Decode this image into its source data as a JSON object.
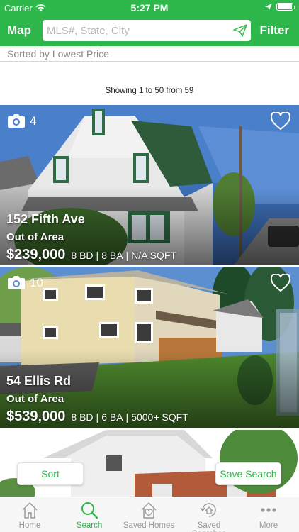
{
  "status": {
    "carrier": "Carrier",
    "time": "5:27 PM"
  },
  "nav": {
    "map_label": "Map",
    "search_placeholder": "MLS#, State, City",
    "filter_label": "Filter"
  },
  "sort_text": "Sorted by Lowest Price",
  "showing_text": "Showing 1 to 50 from 59",
  "listings": [
    {
      "photo_count": "4",
      "address": "152 Fifth Ave",
      "area": "Out of Area",
      "price": "$239,000",
      "beds": "8 BD",
      "baths": "8 BA",
      "sqft": "N/A SQFT"
    },
    {
      "photo_count": "10",
      "address": "54 Ellis Rd",
      "area": "Out of Area",
      "price": "$539,000",
      "beds": "8 BD",
      "baths": "6 BA",
      "sqft": "5000+ SQFT"
    }
  ],
  "buttons": {
    "sort": "Sort",
    "save_search": "Save Search"
  },
  "tabs": [
    {
      "label": "Home",
      "icon": "home-icon"
    },
    {
      "label": "Search",
      "icon": "search-icon",
      "active": true
    },
    {
      "label": "Saved Homes",
      "icon": "saved-home-icon"
    },
    {
      "label": "Saved Searches",
      "icon": "saved-search-icon"
    },
    {
      "label": "More",
      "icon": "more-icon"
    }
  ],
  "colors": {
    "brand_green": "#2eb84b",
    "tab_inactive": "#999999"
  }
}
